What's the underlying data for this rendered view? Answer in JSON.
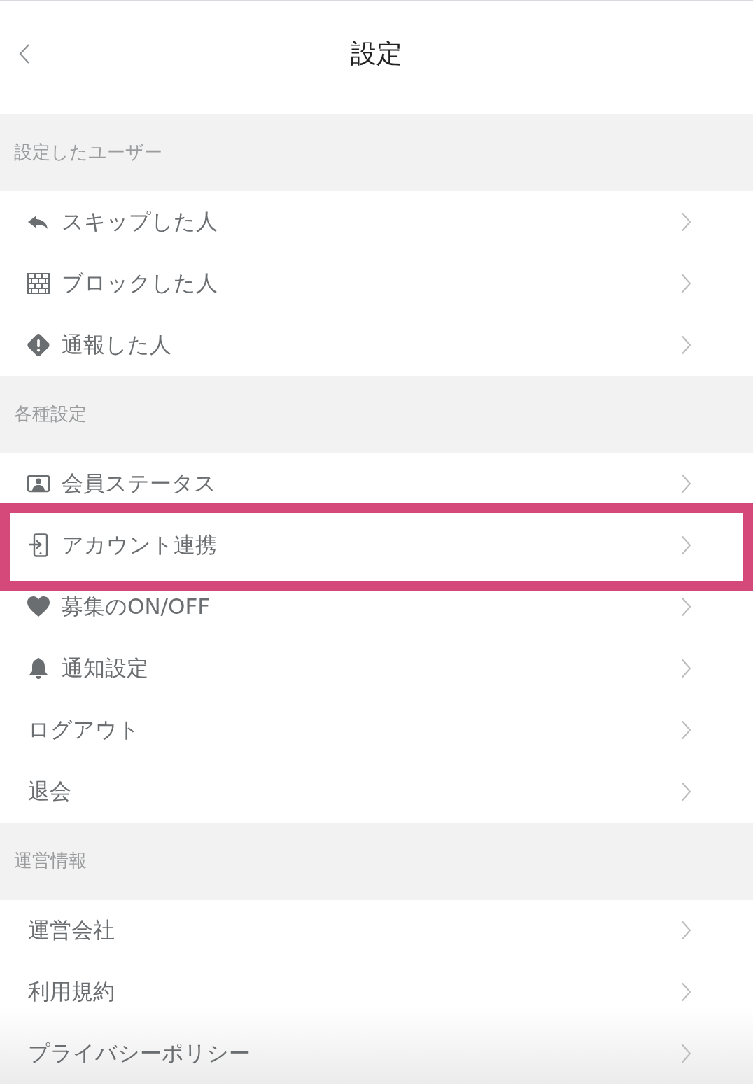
{
  "header": {
    "title": "設定"
  },
  "sections": [
    {
      "title": "設定したユーザー",
      "items": [
        {
          "label": "スキップした人",
          "kind": "reply",
          "highlighted": false
        },
        {
          "label": "ブロックした人",
          "kind": "wall",
          "highlighted": false
        },
        {
          "label": "通報した人",
          "kind": "warning",
          "highlighted": false
        }
      ]
    },
    {
      "title": "各種設定",
      "items": [
        {
          "label": "会員ステータス",
          "kind": "member",
          "highlighted": false
        },
        {
          "label": "アカウント連携",
          "kind": "link",
          "highlighted": true
        },
        {
          "label": "募集のON/OFF",
          "kind": "heart",
          "highlighted": false
        },
        {
          "label": "通知設定",
          "kind": "bell",
          "highlighted": false
        },
        {
          "label": "ログアウト",
          "kind": "plain",
          "highlighted": false
        },
        {
          "label": "退会",
          "kind": "plain",
          "highlighted": false
        }
      ]
    },
    {
      "title": "運営情報",
      "items": [
        {
          "label": "運営会社",
          "kind": "plain",
          "highlighted": false
        },
        {
          "label": "利用規約",
          "kind": "plain",
          "highlighted": false
        },
        {
          "label": "プライバシーポリシー",
          "kind": "plain",
          "highlighted": false
        }
      ]
    }
  ]
}
